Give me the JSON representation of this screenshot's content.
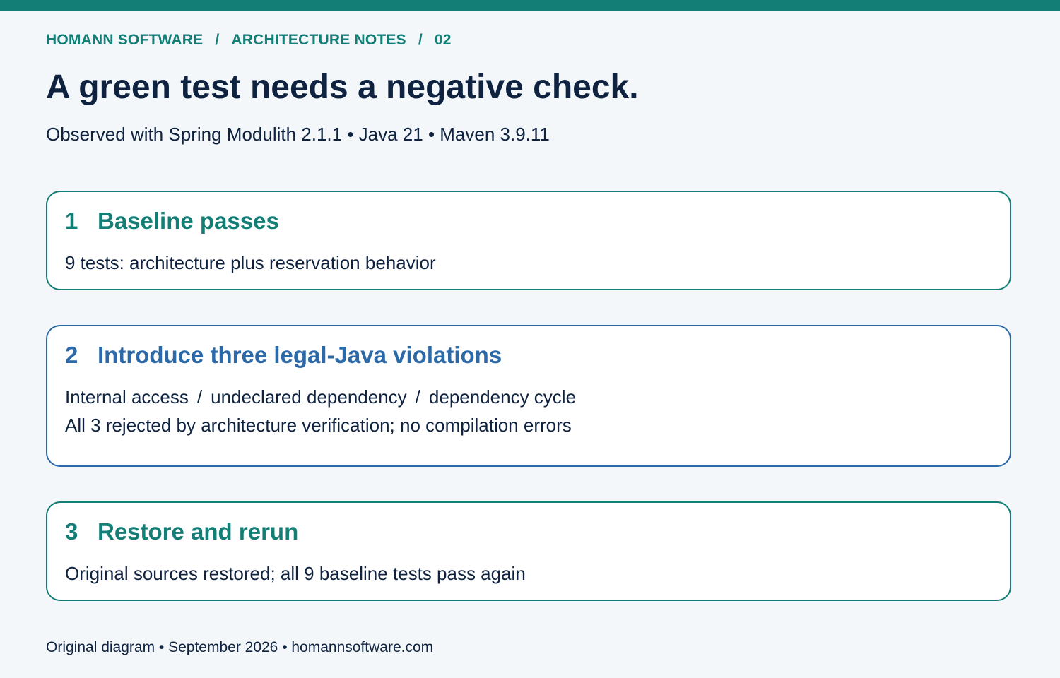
{
  "breadcrumb": {
    "items": [
      "HOMANN SOFTWARE",
      "ARCHITECTURE NOTES",
      "02"
    ],
    "separator": "/"
  },
  "title": "A green test needs a negative check.",
  "subtitle": "Observed with Spring Modulith 2.1.1 • Java 21 • Maven 3.9.11",
  "steps": [
    {
      "number": "1",
      "heading": "Baseline passes",
      "line1": "9 tests: architecture plus reservation behavior"
    },
    {
      "number": "2",
      "heading": "Introduce three legal-Java violations",
      "violations": [
        "Internal access",
        "undeclared dependency",
        "dependency cycle"
      ],
      "separator": "/",
      "line2": "All 3 rejected by architecture verification; no compilation errors"
    },
    {
      "number": "3",
      "heading": "Restore and rerun",
      "line1": "Original sources restored; all 9 baseline tests pass again"
    }
  ],
  "footer": "Original diagram • September 2026 • homannsoftware.com",
  "colors": {
    "teal": "#127e76",
    "blue": "#2b69a8",
    "text": "#0f2340",
    "background": "#f3f7fa"
  }
}
